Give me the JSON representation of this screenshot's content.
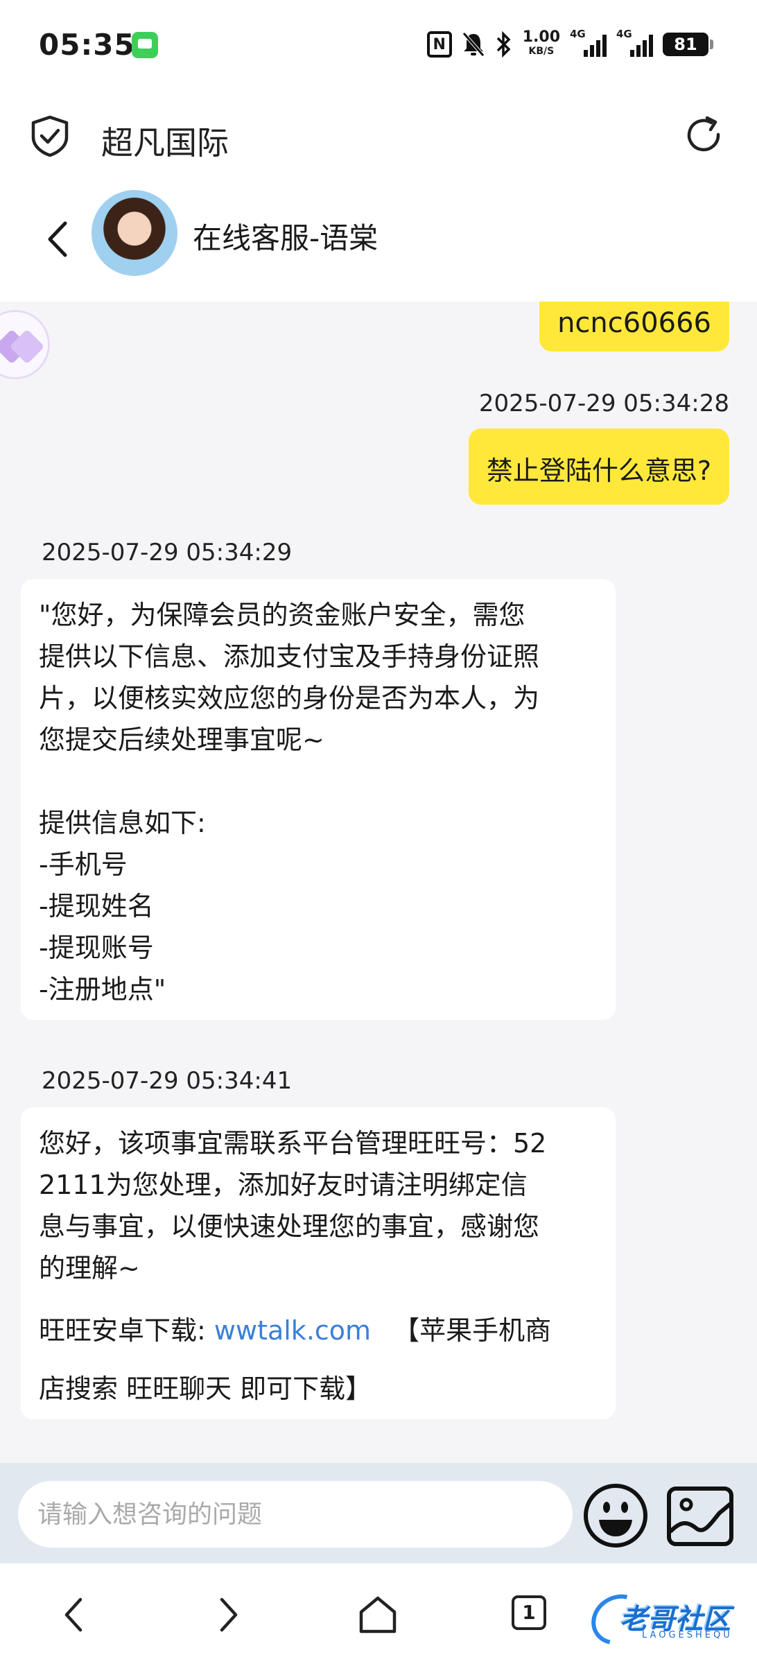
{
  "status_bar": {
    "time": "05:35",
    "net_speed_value": "1.00",
    "net_speed_unit": "KB/S",
    "signal_1": "4G",
    "signal_2": "4G",
    "battery": "81",
    "icons": [
      "message-notification-icon",
      "nfc-icon",
      "mute-bell-icon",
      "bluetooth-icon",
      "signal-icon",
      "battery-icon"
    ]
  },
  "browser": {
    "site_title": "超凡国际",
    "icons": [
      "shield-check-icon",
      "reload-icon"
    ]
  },
  "chat_header": {
    "agent_name": "在线客服-语棠"
  },
  "messages": {
    "outgoing_top": "ncnc60666",
    "timestamp_1": "2025-07-29 05:34:28",
    "outgoing_question": "禁止登陆什么意思?",
    "timestamp_2": "2025-07-29 05:34:29",
    "reply_1_lines": [
      "\"您好，为保障会员的资金账户安全，需您",
      "提供以下信息、添加支付宝及手持身份证照",
      "片，以便核实效应您的身份是否为本人，为",
      "您提交后续处理事宜呢~",
      " ",
      "提供信息如下:",
      "-手机号",
      "-提现姓名",
      "-提现账号",
      "-注册地点\""
    ],
    "timestamp_3": "2025-07-29 05:34:41",
    "reply_2_lines": [
      "您好，该项事宜需联系平台管理旺旺号：52",
      "2111为您处理，添加好友时请注明绑定信",
      "息与事宜，以便快速处理您的事宜，感谢您",
      "的理解~"
    ],
    "reply_2_download_label": "旺旺安卓下载:",
    "reply_2_link": "wwtalk.com",
    "reply_2_ios_line1": "【苹果手机商",
    "reply_2_ios_line2": "店搜索 旺旺聊天 即可下载】"
  },
  "input_bar": {
    "placeholder": "请输入想咨询的问题"
  },
  "nav_bar": {
    "tab_count": "1"
  },
  "watermark": {
    "text": "老哥社区",
    "sub": "LAOGESHEQU"
  },
  "colors": {
    "outgoing_bubble": "#ffe83a",
    "chat_background": "#f5f5f7",
    "link": "#3a7fd8",
    "input_bar": "#e2e8f0"
  }
}
